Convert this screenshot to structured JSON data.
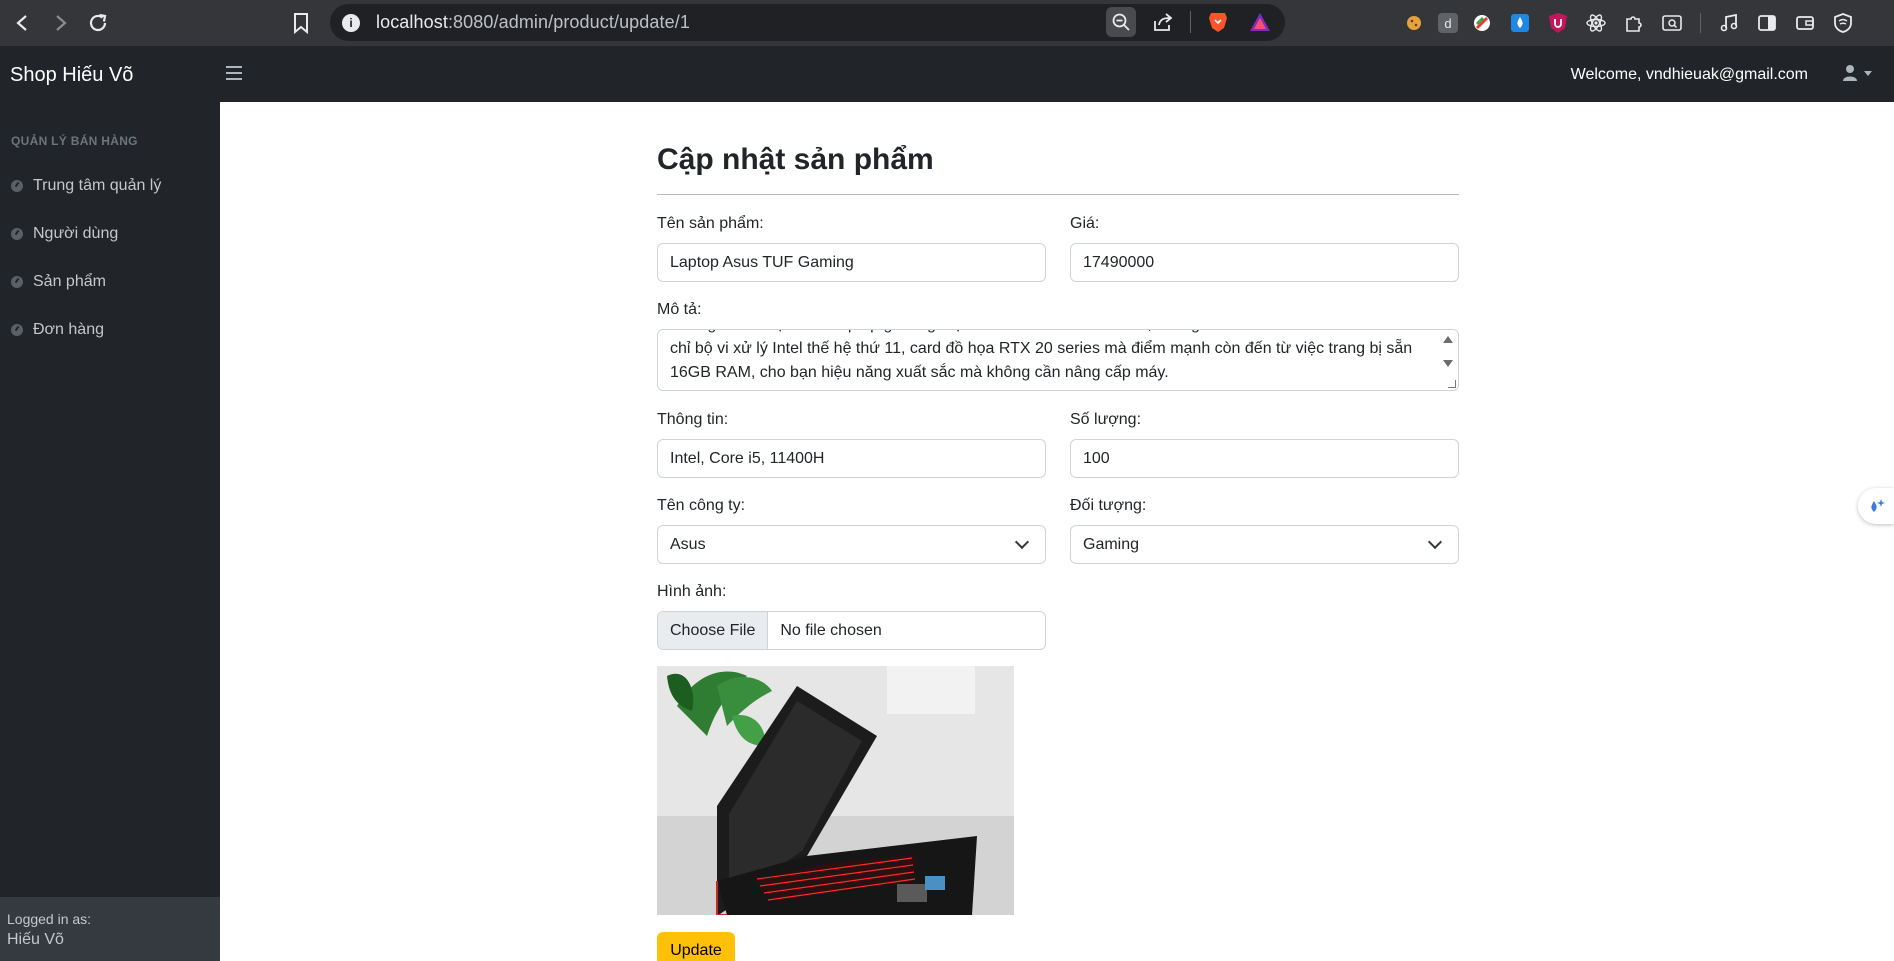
{
  "browser": {
    "url_host": "localhost",
    "url_path": ":8080/admin/product/update/1",
    "info_glyph": "i"
  },
  "navbar": {
    "brand": "Shop Hiếu Võ",
    "welcome": "Welcome, vndhieuak@gmail.com"
  },
  "sidebar": {
    "heading": "QUẢN LÝ BÁN HÀNG",
    "items": [
      {
        "label": "Trung tâm quản lý"
      },
      {
        "label": "Người dùng"
      },
      {
        "label": "Sản phẩm"
      },
      {
        "label": "Đơn hàng"
      }
    ],
    "footer_label": "Logged in as:",
    "footer_user": "Hiếu Võ"
  },
  "form": {
    "title": "Cập nhật sản phẩm",
    "name_label": "Tên sản phẩm:",
    "name_value": "Laptop Asus TUF Gaming",
    "price_label": "Giá:",
    "price_value": "17490000",
    "desc_label": "Mô tả:",
    "desc_lines": [
      "Không chỉ là một chiếc laptop gaming mạnh mẽ với thiết kế hầm hố, không",
      "chỉ bộ vi xử lý Intel thế hệ thứ 11, card đồ họa RTX 20 series mà điểm mạnh còn đến từ việc trang bị sẵn",
      "16GB RAM, cho bạn hiệu năng xuất sắc mà không cần nâng cấp máy."
    ],
    "info_label": "Thông tin:",
    "info_value": "Intel, Core i5, 11400H",
    "qty_label": "Số lượng:",
    "qty_value": "100",
    "company_label": "Tên công ty:",
    "company_value": "Asus",
    "target_label": "Đối tượng:",
    "target_value": "Gaming",
    "image_label": "Hình ảnh:",
    "file_button": "Choose File",
    "file_status": "No file chosen",
    "submit_label": "Update"
  },
  "colors": {
    "sidebar_bg": "#212529",
    "update_button": "#ffc107",
    "browser_bg": "#35363a"
  }
}
